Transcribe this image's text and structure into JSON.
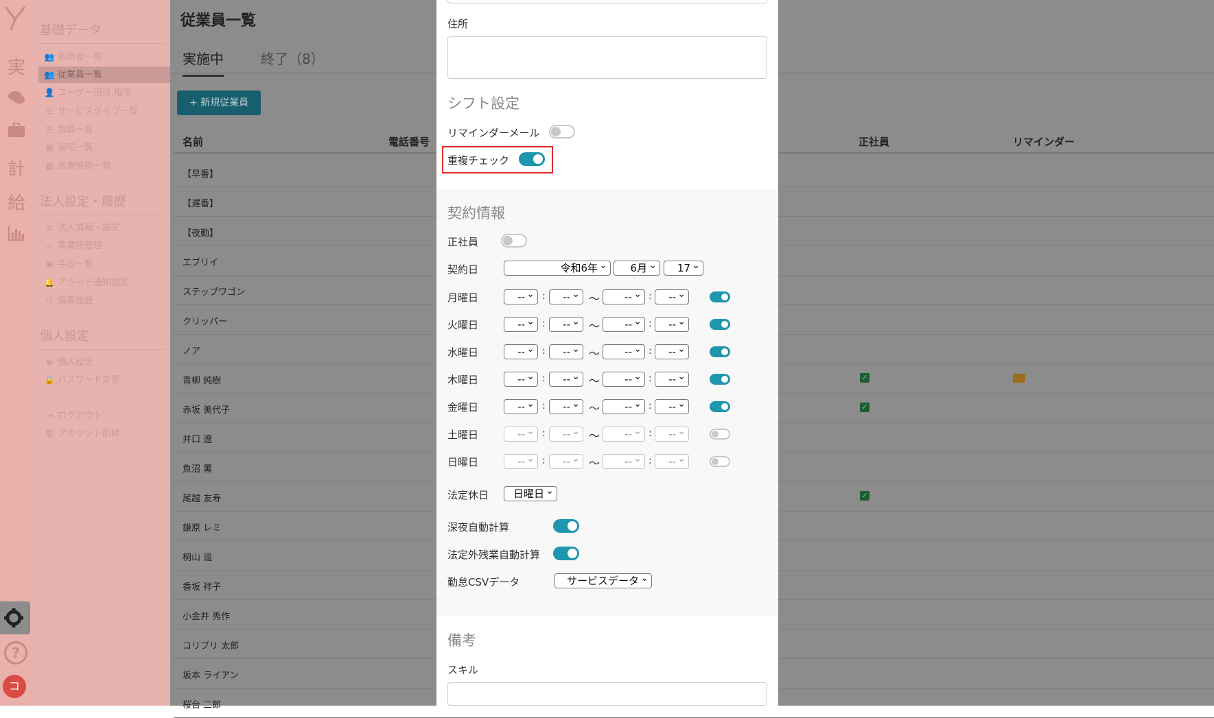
{
  "sidebar": {
    "sections": [
      {
        "title": "基礎データ",
        "items": [
          "利用者一覧",
          "従業員一覧",
          "ユーザー招待.権限",
          "サービスタイプ一覧",
          "加算一覧",
          "居宅一覧",
          "医療機関一覧"
        ]
      },
      {
        "title": "法人設定・履歴",
        "items": [
          "法人情報・設定",
          "事業所管理",
          "手当一覧",
          "アラート通知設定",
          "編集履歴"
        ]
      },
      {
        "title": "個人設定",
        "items": [
          "個人設定",
          "パスワード変更"
        ]
      }
    ],
    "bottom_items": [
      "ログアウト",
      "アカウント削除"
    ]
  },
  "rail": {
    "labels": [
      "実",
      "計",
      "給"
    ],
    "avatar": "コ"
  },
  "main": {
    "title": "従業員一覧",
    "tabs": [
      "実施中",
      "終了（8）"
    ],
    "new_button": "+ 新規従業員",
    "columns": {
      "name": "名前",
      "phone": "電話番号",
      "regular": "正社員",
      "reminder": "リマインダー"
    },
    "rows": [
      "【早番】",
      "【遅番】",
      "【夜勤】",
      "エブリイ",
      "ステップワゴン",
      "クリッパー",
      "ノア",
      "青柳 純樹",
      "赤坂 美代子",
      "井口 遼",
      "魚沼 薫",
      "尾越 友寿",
      "鎌原 レミ",
      "桐山 遥",
      "香坂 祥子",
      "小金井 秀作",
      "コリブリ 太郎",
      "坂本 ライアン",
      "桜台 二郎"
    ]
  },
  "modal": {
    "address_label": "住所",
    "shift_section": "シフト設定",
    "reminder_mail_label": "リマインダーメール",
    "duplicate_check_label": "重複チェック",
    "contract_section": "契約情報",
    "regular_label": "正社員",
    "contract_date_label": "契約日",
    "contract_date": {
      "era_year": "令和6年",
      "month": "6月",
      "day": "17"
    },
    "weekdays": [
      "月曜日",
      "火曜日",
      "水曜日",
      "木曜日",
      "金曜日",
      "土曜日",
      "日曜日"
    ],
    "time_placeholder": "--",
    "colon": ":",
    "tilde": "〜",
    "legal_holiday_label": "法定休日",
    "legal_holiday_value": "日曜日",
    "night_auto_label": "深夜自動計算",
    "overtime_auto_label": "法定外残業自動計算",
    "csv_label": "勤怠CSVデータ",
    "csv_value": "サービスデータ",
    "notes_section": "備考",
    "skill_label": "スキル"
  }
}
